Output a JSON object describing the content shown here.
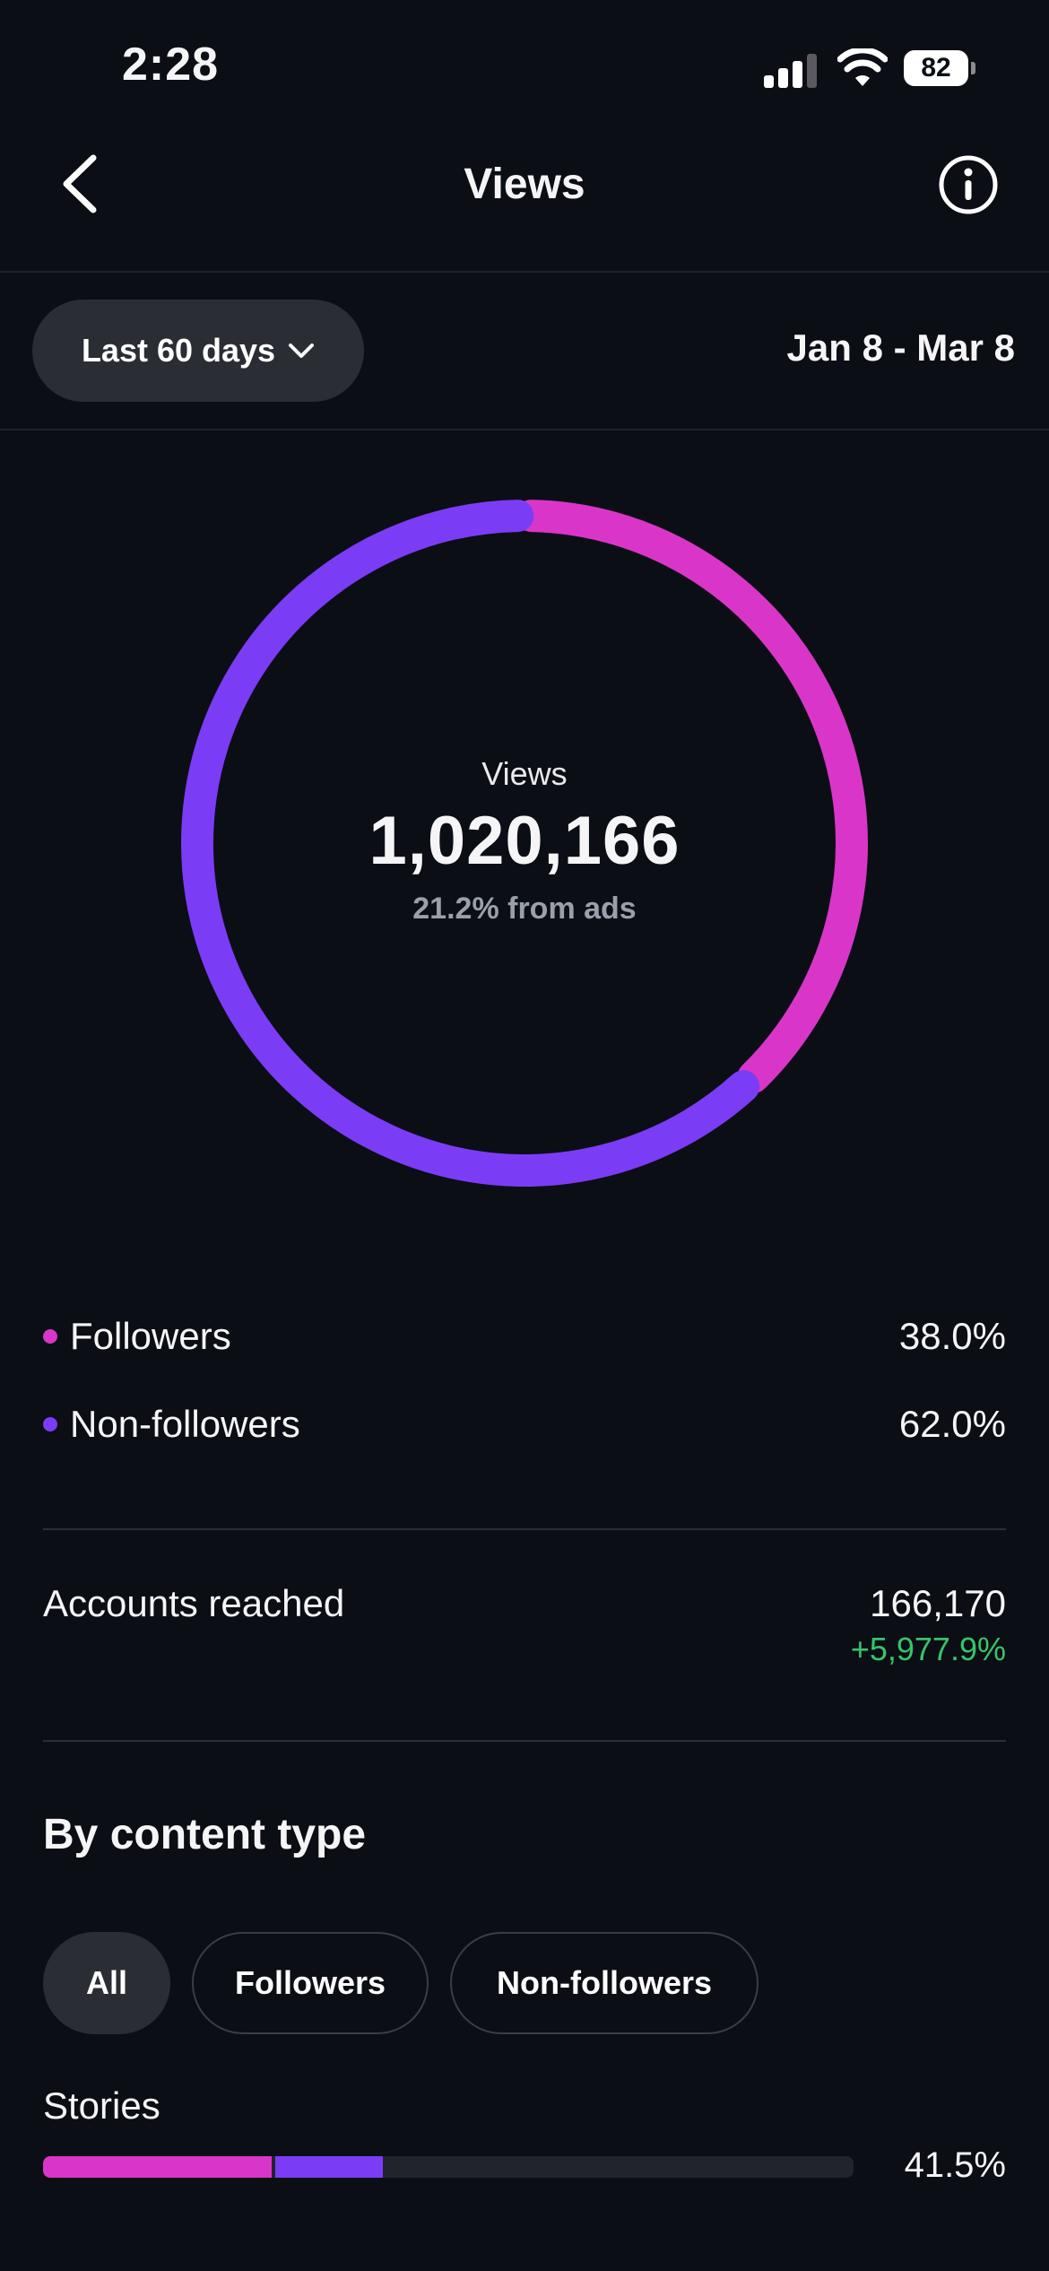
{
  "status_bar": {
    "time": "2:28",
    "battery": "82"
  },
  "header": {
    "title": "Views",
    "back_icon": "chevron-left-icon",
    "info_icon": "info-icon"
  },
  "range": {
    "selector_label": "Last 60 days",
    "date_range": "Jan 8 - Mar 8"
  },
  "summary": {
    "label": "Views",
    "value": "1,020,166",
    "subtitle": "21.2% from ads"
  },
  "legend": [
    {
      "label": "Followers",
      "value": "38.0%",
      "color": "#d936c9"
    },
    {
      "label": "Non-followers",
      "value": "62.0%",
      "color": "#7b3cf6"
    }
  ],
  "chart_data": {
    "type": "pie",
    "variant": "donut",
    "categories": [
      "Followers",
      "Non-followers"
    ],
    "values": [
      38.0,
      62.0
    ],
    "colors": [
      "#d936c9",
      "#7b3cf6"
    ]
  },
  "accounts_reached": {
    "label": "Accounts reached",
    "value": "166,170",
    "change": "+5,977.9%"
  },
  "content_type": {
    "title": "By content type",
    "filters": [
      {
        "label": "All",
        "active": true
      },
      {
        "label": "Followers",
        "active": false
      },
      {
        "label": "Non-followers",
        "active": false
      }
    ],
    "items": [
      {
        "label": "Stories",
        "percent": "41.5%",
        "followers_share": 28.2,
        "non_followers_share": 13.3
      }
    ]
  }
}
